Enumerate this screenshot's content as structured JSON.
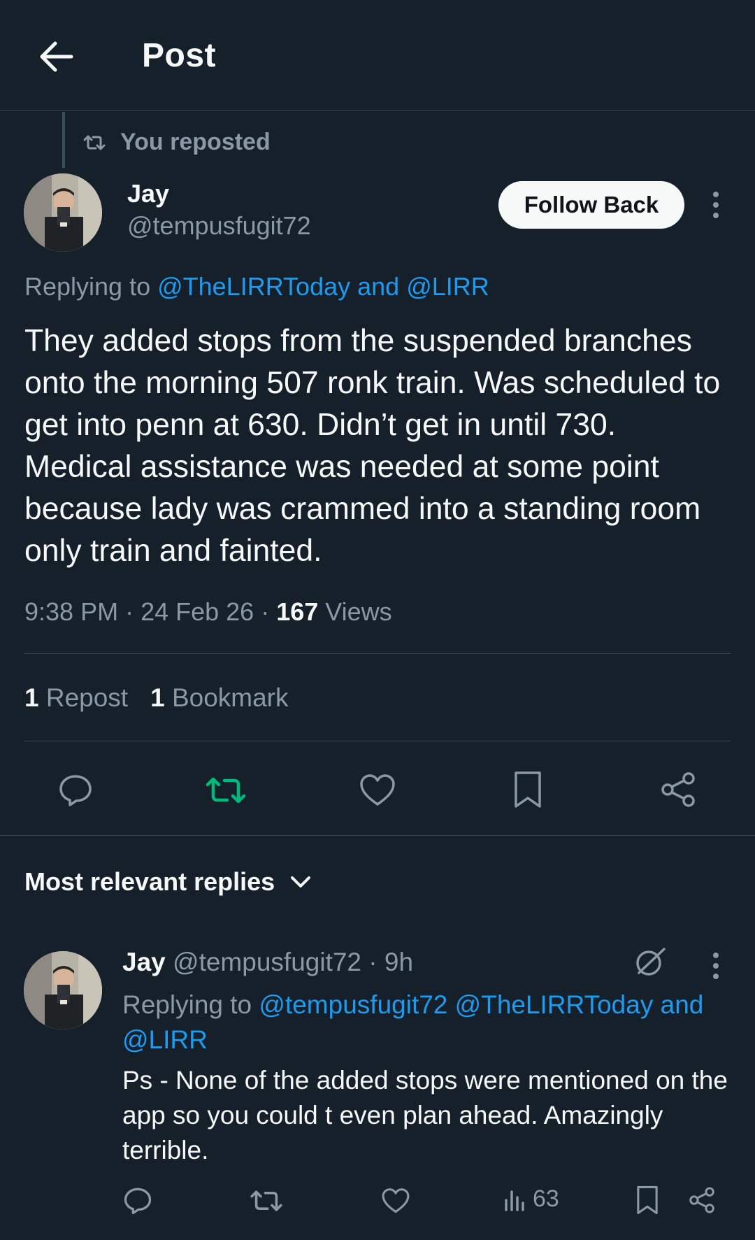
{
  "header": {
    "title": "Post"
  },
  "repost_banner": {
    "label": "You reposted"
  },
  "post": {
    "author_name": "Jay",
    "author_handle": "@tempusfugit72",
    "follow_label": "Follow Back",
    "replying_prefix": "Replying to ",
    "replying_mention_1": "@TheLIRRToday",
    "replying_joiner": " and ",
    "replying_mention_2": "@LIRR",
    "text": "They added stops from the suspended branches onto the morning 507 ronk train. Was scheduled to get into penn at 630.  Didn’t get in until 730. Medical assistance was needed at some point because lady was crammed into a standing room only train and fainted.",
    "time": "9:38 PM",
    "separator": " · ",
    "date": "24 Feb 26",
    "views_count": "167",
    "views_label": " Views",
    "repost_count": "1",
    "repost_label": " Repost",
    "bookmark_count": "1",
    "bookmark_label": " Bookmark"
  },
  "replies_section": {
    "label": "Most relevant replies"
  },
  "reply": {
    "author_name": "Jay",
    "author_handle": " @tempusfugit72",
    "time": " · 9h",
    "replying_prefix": "Replying to ",
    "mention_1": "@tempusfugit72",
    "mention_2": " @TheLIRRToday",
    "joiner": " and ",
    "mention_3": "@LIRR",
    "text": "Ps -  None of the added stops were mentioned on the app so you could t even plan ahead. Amazingly terrible.",
    "views_count": "63"
  },
  "colors": {
    "background": "#15202b",
    "text": "#f7f9f9",
    "muted": "#8b98a5",
    "link": "#1d9bf0",
    "repost_active": "#00ba7c",
    "divider": "#38444d"
  },
  "icons": [
    "back-arrow-icon",
    "repost-icon",
    "more-icon",
    "reply-icon",
    "like-icon",
    "bookmark-icon",
    "share-icon",
    "chevron-down-icon",
    "grok-icon",
    "views-icon"
  ]
}
